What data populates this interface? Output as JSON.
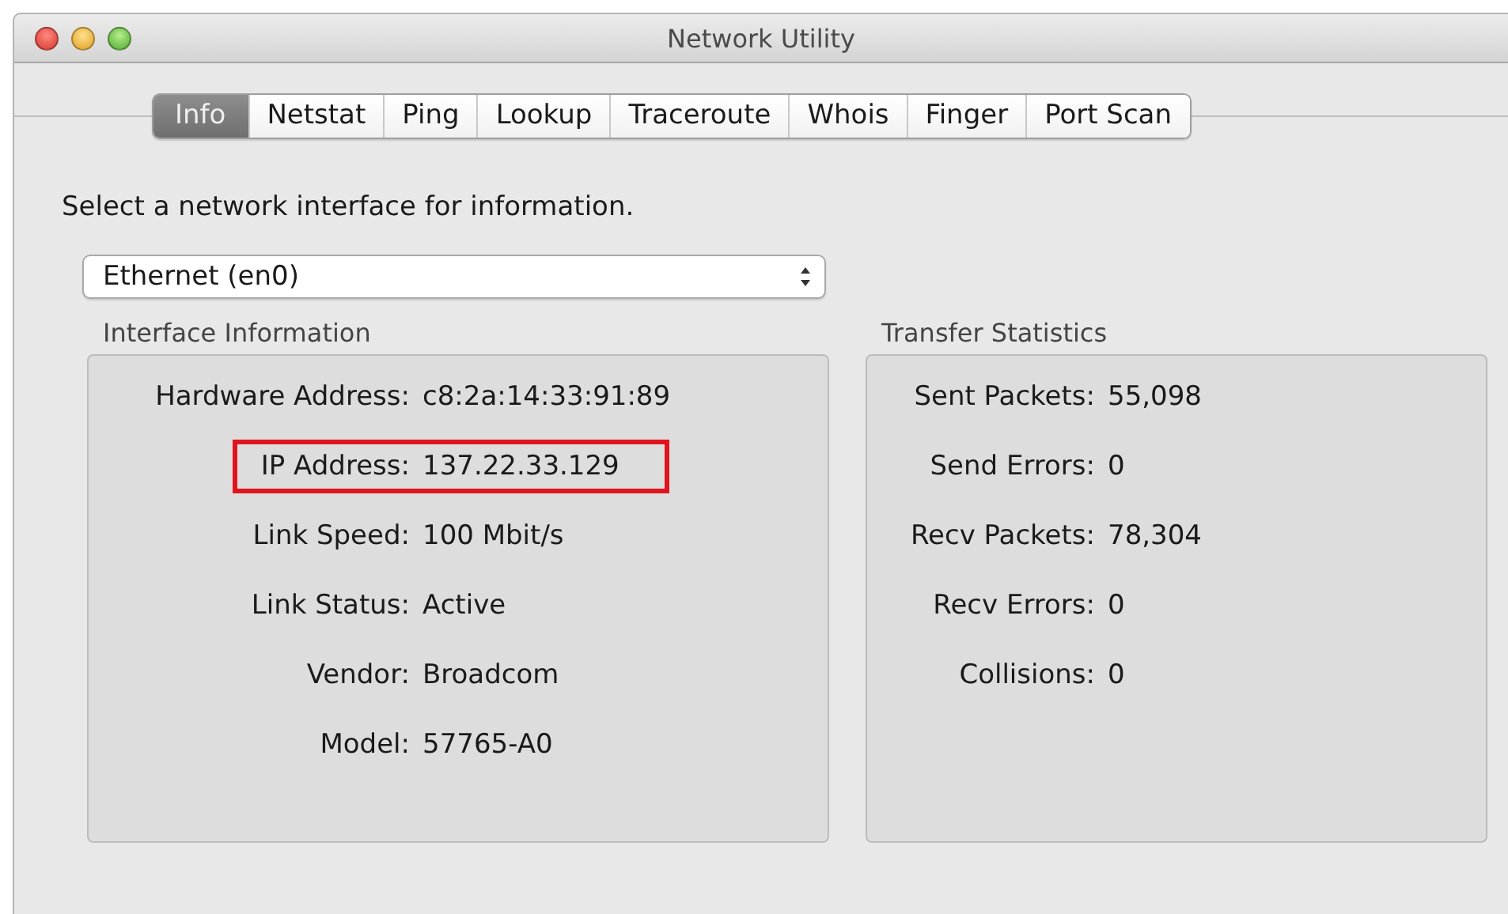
{
  "window": {
    "title": "Network Utility"
  },
  "tabs": [
    {
      "label": "Info",
      "selected": true
    },
    {
      "label": "Netstat",
      "selected": false
    },
    {
      "label": "Ping",
      "selected": false
    },
    {
      "label": "Lookup",
      "selected": false
    },
    {
      "label": "Traceroute",
      "selected": false
    },
    {
      "label": "Whois",
      "selected": false
    },
    {
      "label": "Finger",
      "selected": false
    },
    {
      "label": "Port Scan",
      "selected": false
    }
  ],
  "prompt": "Select a network interface for information.",
  "interface_select": {
    "value": "Ethernet (en0)"
  },
  "interface_information": {
    "title": "Interface Information",
    "rows": [
      {
        "label": "Hardware Address:",
        "value": "c8:2a:14:33:91:89",
        "highlighted": false
      },
      {
        "label": "IP Address:",
        "value": "137.22.33.129",
        "highlighted": true
      },
      {
        "label": "Link Speed:",
        "value": "100 Mbit/s",
        "highlighted": false
      },
      {
        "label": "Link Status:",
        "value": "Active",
        "highlighted": false
      },
      {
        "label": "Vendor:",
        "value": "Broadcom",
        "highlighted": false
      },
      {
        "label": "Model:",
        "value": "57765-A0",
        "highlighted": false
      }
    ]
  },
  "transfer_statistics": {
    "title": "Transfer Statistics",
    "rows": [
      {
        "label": "Sent Packets:",
        "value": "55,098",
        "highlighted": false
      },
      {
        "label": "Send Errors:",
        "value": "0",
        "highlighted": false
      },
      {
        "label": "Recv Packets:",
        "value": "78,304",
        "highlighted": false
      },
      {
        "label": "Recv Errors:",
        "value": "0",
        "highlighted": false
      },
      {
        "label": "Collisions:",
        "value": "0",
        "highlighted": false
      }
    ]
  }
}
